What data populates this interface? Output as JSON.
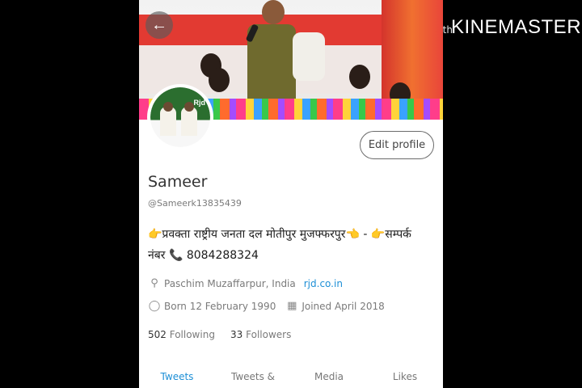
{
  "watermark": {
    "small": "Made with",
    "big": "KINEMASTER"
  },
  "profile": {
    "name": "Sameer",
    "handle": "@Sameerk13835439",
    "edit_label": "Edit profile",
    "avatar_text": "Rjd",
    "bio_line1": "👉प्रवक्ता राष्ट्रीय जनता दल मोतीपुर मुजफ्फरपुर👈    -    👉सम्पर्क",
    "bio_line2": "नंबर 📞 8084288324",
    "location": "Paschim Muzaffarpur, India",
    "website": "rjd.co.in",
    "born": "Born 12 February 1990",
    "joined": "Joined April 2018",
    "following_count": "502",
    "following_label": "Following",
    "followers_count": "33",
    "followers_label": "Followers"
  },
  "tabs": [
    "Tweets",
    "Tweets & replies",
    "Media",
    "Likes"
  ],
  "icons": {
    "back": "arrow-left-icon",
    "location": "location-pin-icon",
    "birthday": "balloon-icon",
    "calendar": "calendar-icon"
  },
  "colors": {
    "link": "#1d8fd6",
    "text": "#333333",
    "muted": "#7a7a7a"
  }
}
